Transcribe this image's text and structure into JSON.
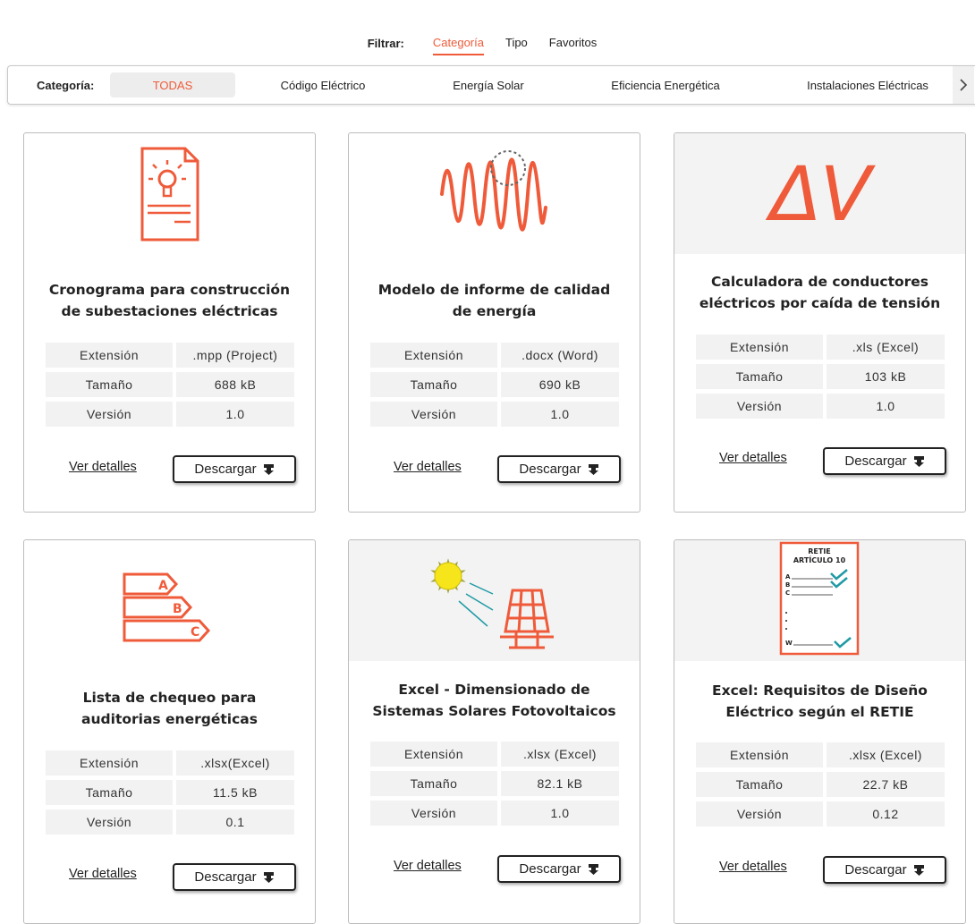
{
  "filter": {
    "label": "Filtrar:",
    "options": [
      "Categoría",
      "Tipo",
      "Favoritos"
    ]
  },
  "categories": {
    "label": "Categoría:",
    "items": [
      "TODAS",
      "Código Eléctrico",
      "Energía Solar",
      "Eficiencia Energética",
      "Instalaciones Eléctricas"
    ],
    "next_icon": "chevron-right-icon"
  },
  "colors": {
    "accent": "#ef5b3a",
    "teal": "#1f9aa6",
    "sun": "#f5e51a"
  },
  "card_labels": {
    "extension": "Extensión",
    "size": "Tamaño",
    "version": "Versión",
    "details": "Ver detalles",
    "download": "Descargar"
  },
  "cards": [
    {
      "icon": "document-lightbulb-icon",
      "title": "Cronograma para construcción de subestaciones eléctricas",
      "extension": ".mpp (Project)",
      "size": "688 kB",
      "version": "1.0"
    },
    {
      "icon": "waveform-icon",
      "title": "Modelo de informe de calidad de energía",
      "extension": ".docx (Word)",
      "size": "690 kB",
      "version": "1.0"
    },
    {
      "icon": "delta-v-icon",
      "icon_text": "ΔV",
      "title": "Calculadora de conductores eléctricos por caída de tensión",
      "extension": ".xls (Excel)",
      "size": "103 kB",
      "version": "1.0"
    },
    {
      "icon": "energy-rating-icon",
      "icon_letters": [
        "A",
        "B",
        "C"
      ],
      "title": "Lista de chequeo para auditorias energéticas",
      "extension": ".xlsx(Excel)",
      "size": "11.5 kB",
      "version": "0.1"
    },
    {
      "icon": "solar-panel-icon",
      "title": "Excel - Dimensionado de Sistemas Solares Fotovoltaicos",
      "extension": ".xlsx (Excel)",
      "size": "82.1 kB",
      "version": "1.0"
    },
    {
      "icon": "retie-checklist-icon",
      "icon_text": [
        "RETIE",
        "ARTÍCULO 10",
        "A",
        "B",
        "C",
        "W"
      ],
      "title": "Excel: Requisitos de Diseño Eléctrico según el RETIE",
      "extension": ".xlsx (Excel)",
      "size": "22.7 kB",
      "version": "0.12"
    }
  ]
}
